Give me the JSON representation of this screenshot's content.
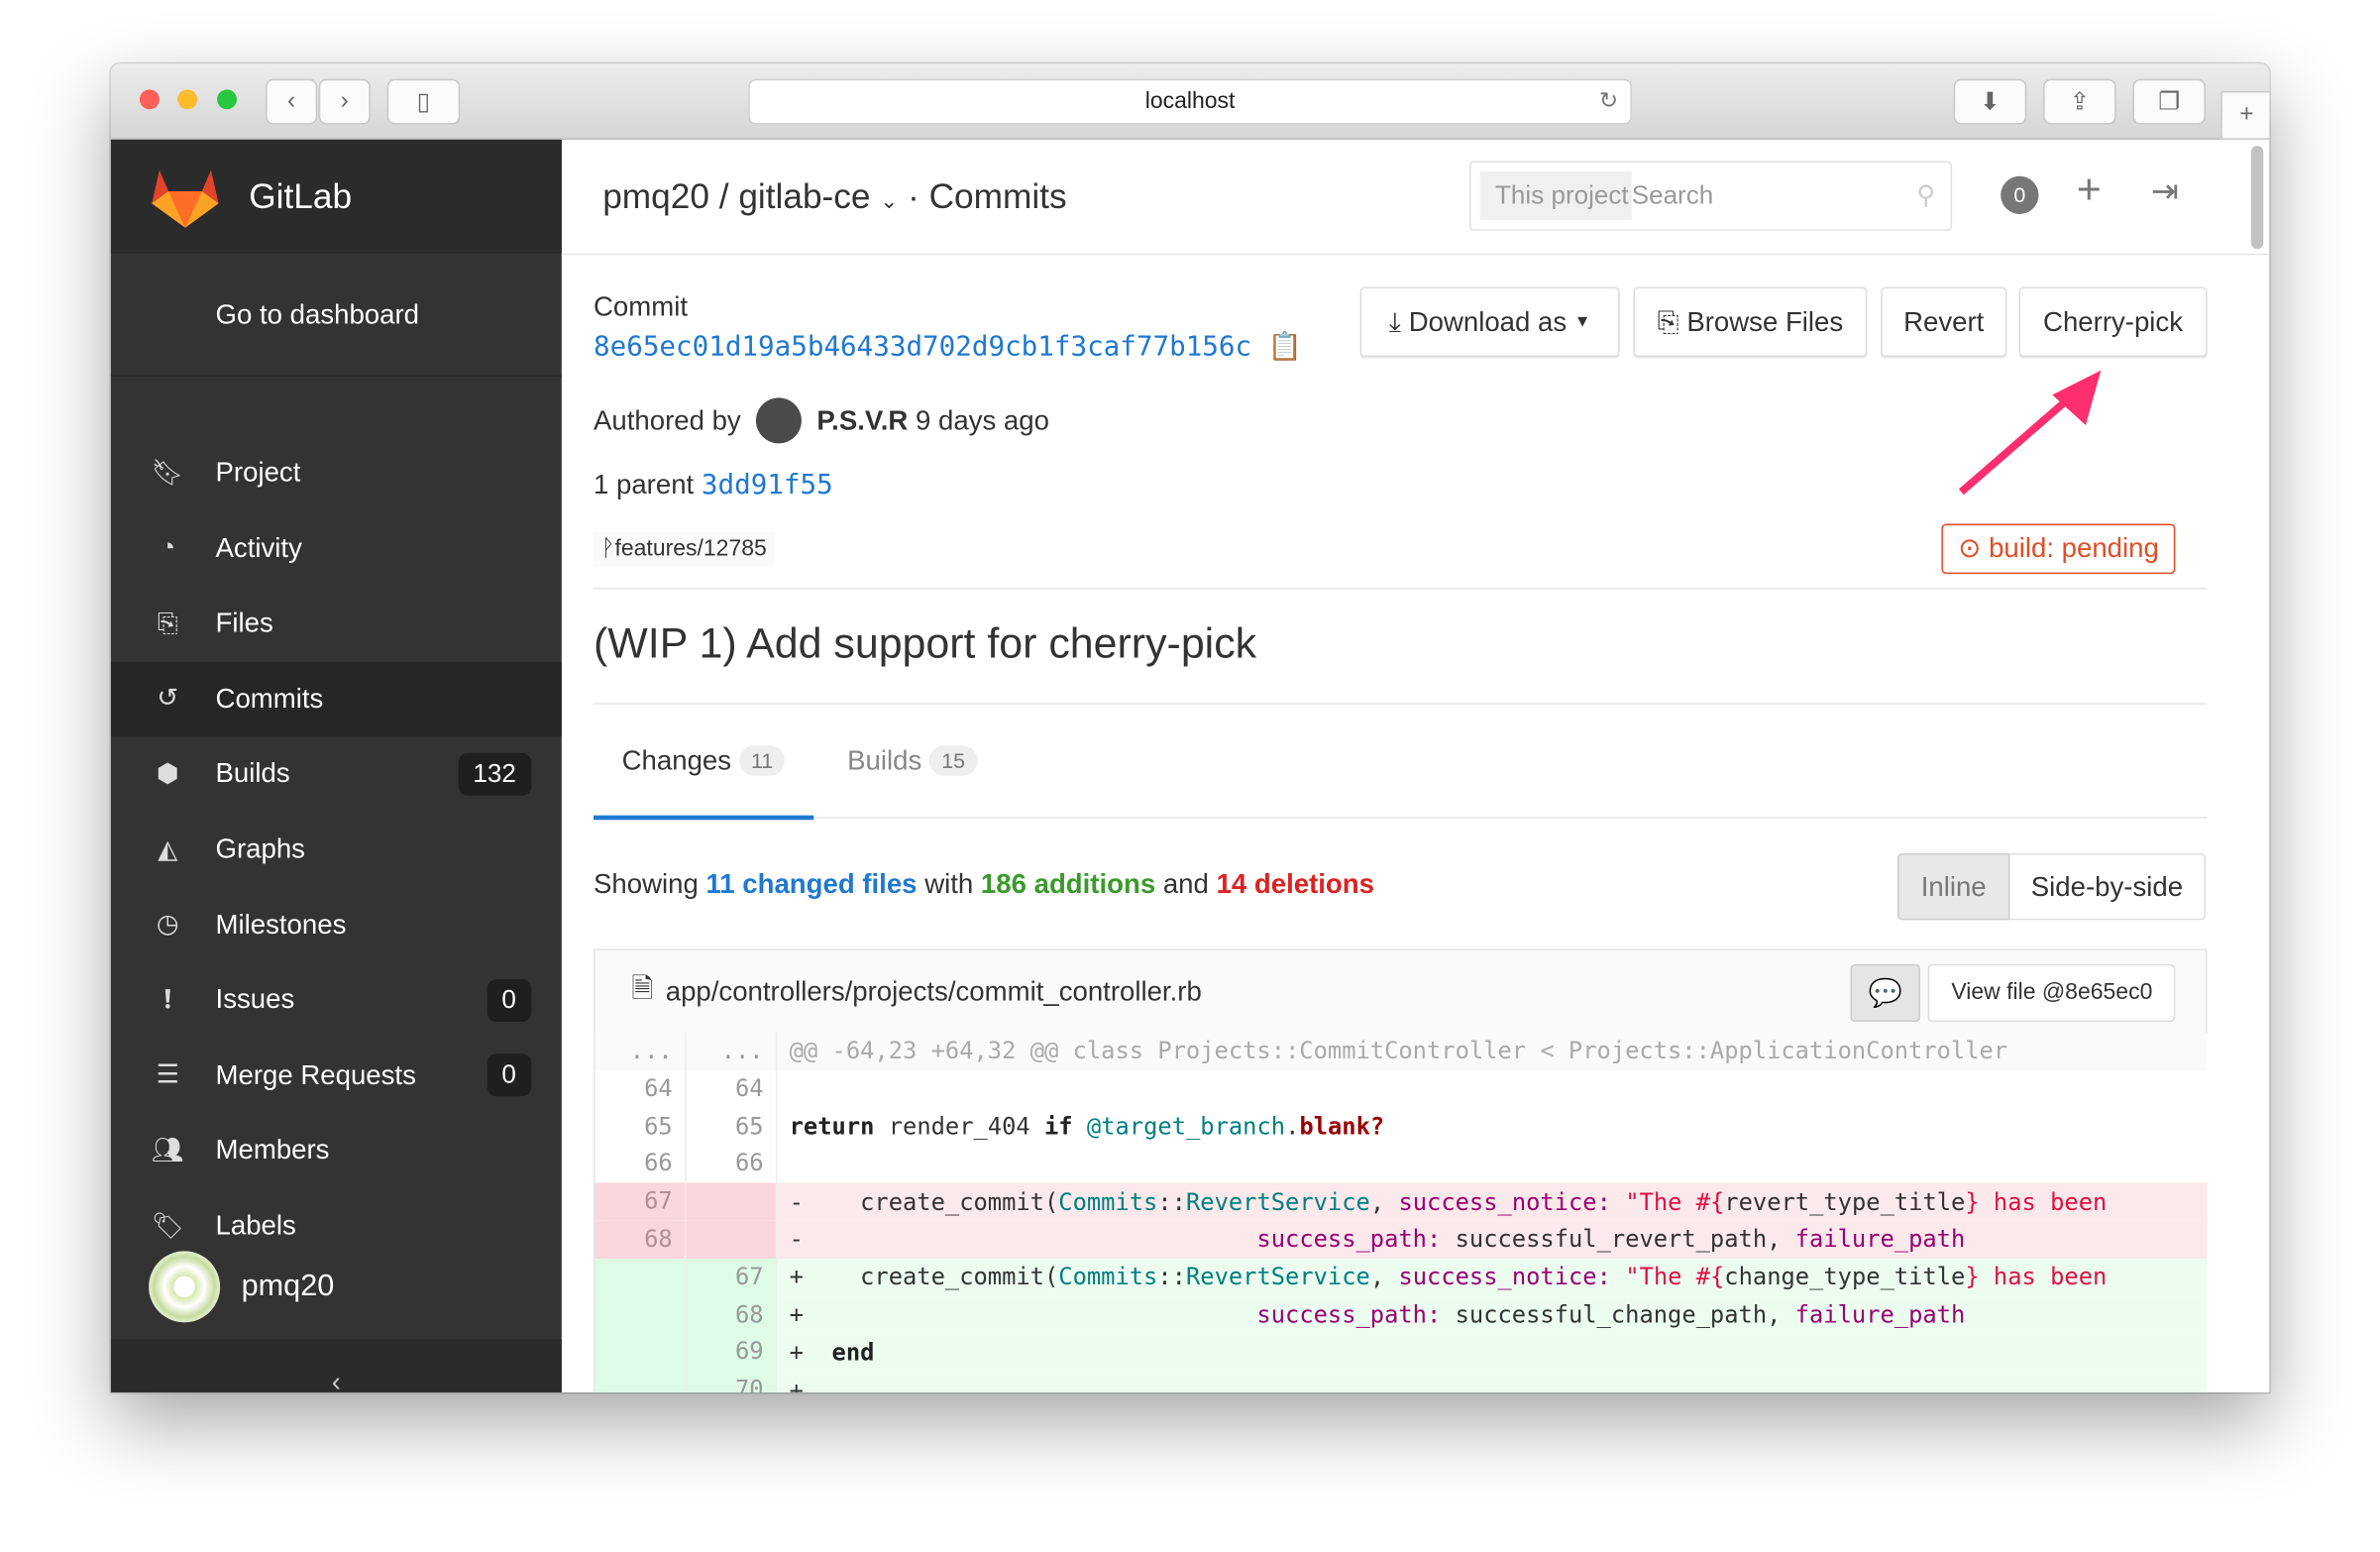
{
  "browser": {
    "url": "localhost"
  },
  "sidebar": {
    "brand": "GitLab",
    "dashboard": "Go to dashboard",
    "items": [
      {
        "label": "Project",
        "icon": "bookmark-icon"
      },
      {
        "label": "Activity",
        "icon": "dashboard-icon"
      },
      {
        "label": "Files",
        "icon": "files-icon"
      },
      {
        "label": "Commits",
        "icon": "history-icon",
        "active": true
      },
      {
        "label": "Builds",
        "icon": "cubes-icon",
        "count": "132"
      },
      {
        "label": "Graphs",
        "icon": "area-chart-icon"
      },
      {
        "label": "Milestones",
        "icon": "clock-icon"
      },
      {
        "label": "Issues",
        "icon": "exclamation-icon",
        "count": "0"
      },
      {
        "label": "Merge Requests",
        "icon": "list-icon",
        "count": "0"
      },
      {
        "label": "Members",
        "icon": "users-icon"
      },
      {
        "label": "Labels",
        "icon": "tags-icon"
      }
    ],
    "user": "pmq20",
    "collapse": "‹"
  },
  "header": {
    "owner": "pmq20",
    "project": "gitlab-ce",
    "section": "Commits",
    "search_scope": "This project",
    "search_placeholder": "Search",
    "todos": "0"
  },
  "commit": {
    "label": "Commit",
    "sha": "8e65ec01d19a5b46433d702d9cb1f3caf77b156c",
    "authored_by": "Authored by",
    "author": "P.S.V.R",
    "time": "9 days ago",
    "parent_label": "1 parent",
    "parent_sha": "3dd91f55",
    "branch": "features/12785",
    "build_status": "build: pending",
    "title": "(WIP 1) Add support for cherry-pick"
  },
  "actions": {
    "download": "Download as",
    "browse": "Browse Files",
    "revert": "Revert",
    "cherry_pick": "Cherry-pick"
  },
  "tabs": [
    {
      "label": "Changes",
      "count": "11"
    },
    {
      "label": "Builds",
      "count": "15"
    }
  ],
  "summary": {
    "showing": "Showing",
    "changed": "11 changed files",
    "with": "with",
    "additions": "186 additions",
    "and": "and",
    "deletions": "14 deletions"
  },
  "view_toggle": {
    "inline": "Inline",
    "side": "Side-by-side"
  },
  "file": {
    "path": "app/controllers/projects/commit_controller.rb",
    "view": "View file @8e65ec0"
  },
  "diff": {
    "hunk": "@@ -64,23 +64,32 @@ class Projects::CommitController < Projects::ApplicationController"
  },
  "colors": {
    "accent": "#1f78d1",
    "addition": "#3a9a2b",
    "deletion": "#d22",
    "arrow": "#ff2e6e"
  }
}
